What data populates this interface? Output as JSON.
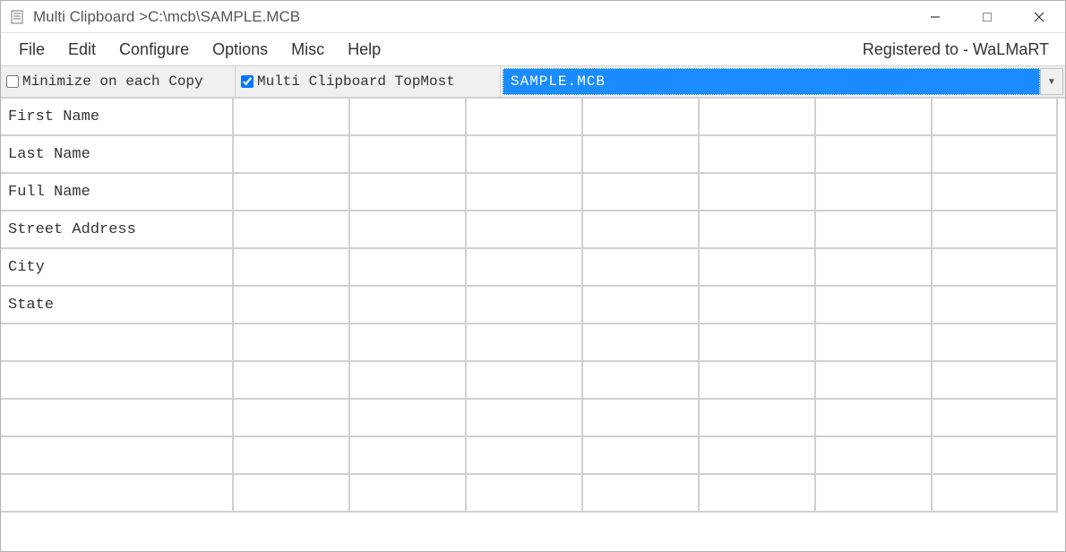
{
  "title_bar": {
    "title": "Multi Clipboard >C:\\mcb\\SAMPLE.MCB"
  },
  "menu": {
    "items": [
      "File",
      "Edit",
      "Configure",
      "Options",
      "Misc",
      "Help"
    ],
    "registered_to": "Registered to - WaLMaRT"
  },
  "toolbar": {
    "minimize_label": "Minimize on each Copy",
    "minimize_checked": false,
    "topmost_label": "Multi Clipboard TopMost",
    "topmost_checked": true,
    "dropdown_value": "SAMPLE.MCB"
  },
  "grid": {
    "columns": 8,
    "row_labels": [
      "First Name",
      "Last Name",
      "Full Name",
      "Street Address",
      "City",
      "State",
      "",
      "",
      "",
      "",
      ""
    ]
  }
}
